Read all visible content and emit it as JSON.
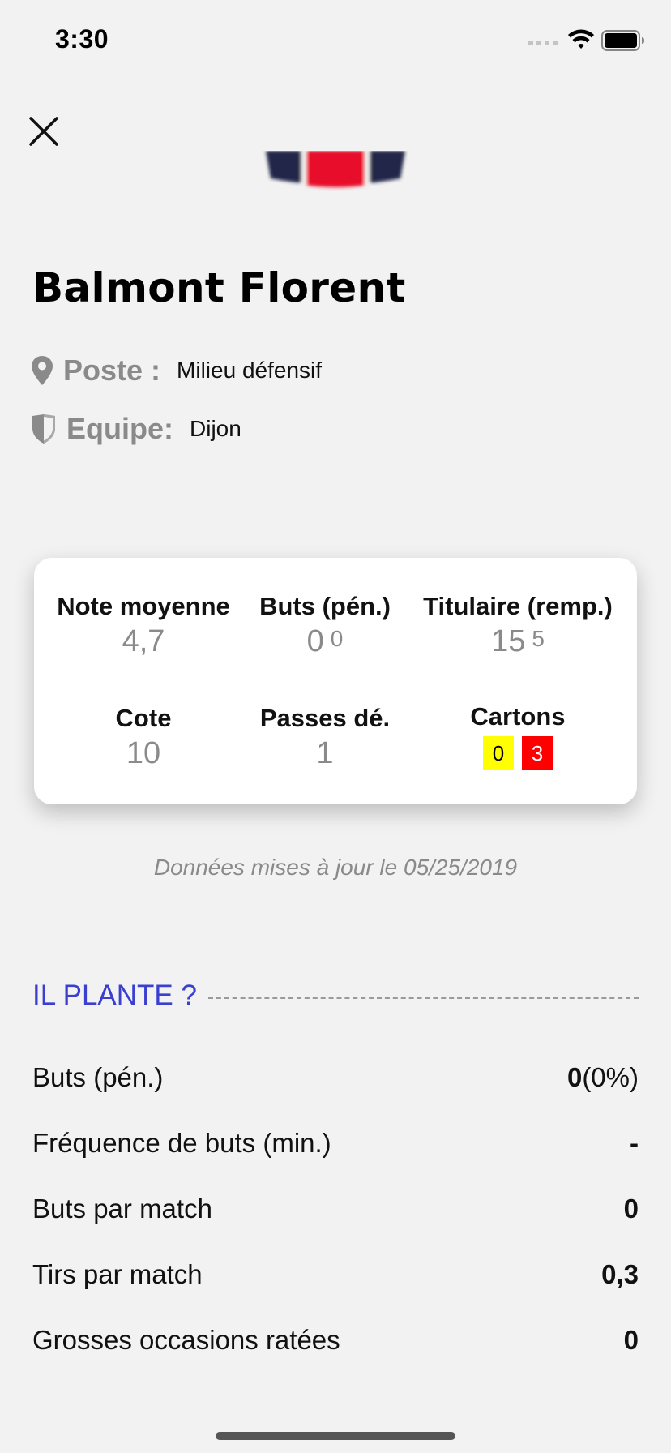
{
  "status_bar": {
    "time": "3:30"
  },
  "player": {
    "name": "Balmont Florent",
    "poste_label": "Poste :",
    "poste_value": "Milieu défensif",
    "equipe_label": "Equipe:",
    "equipe_value": "Dijon"
  },
  "stats_card": {
    "note_moyenne": {
      "title": "Note moyenne",
      "value": "4,7"
    },
    "buts": {
      "title": "Buts (pén.)",
      "value": "0",
      "sup": "0"
    },
    "titulaire": {
      "title": "Titulaire (remp.)",
      "value": "15",
      "sup": "5"
    },
    "cote": {
      "title": "Cote",
      "value": "10"
    },
    "passes": {
      "title": "Passes dé.",
      "value": "1"
    },
    "cartons": {
      "title": "Cartons",
      "yellow": "0",
      "red": "3"
    }
  },
  "update_note": "Données mises à jour le 05/25/2019",
  "section": {
    "title": "IL PLANTE ?",
    "rows": [
      {
        "label": "Buts (pén.)",
        "value": "0",
        "suffix": "(0%)"
      },
      {
        "label": "Fréquence de buts (min.)",
        "value": "-",
        "suffix": ""
      },
      {
        "label": "Buts par match",
        "value": "0",
        "suffix": ""
      },
      {
        "label": "Tirs par match",
        "value": "0,3",
        "suffix": ""
      },
      {
        "label": "Grosses occasions ratées",
        "value": "0",
        "suffix": ""
      }
    ]
  },
  "colors": {
    "accent": "#3a3fd0",
    "card_yellow": "#ffff00",
    "card_red": "#ff0000",
    "muted": "#8a8a8a",
    "background": "#f2f2f2"
  },
  "icons": {
    "close": "close-icon",
    "location": "location-pin-icon",
    "team": "shield-icon",
    "signal": "cellular-signal-icon",
    "wifi": "wifi-icon",
    "battery": "battery-icon",
    "jersey": "team-jersey-image"
  }
}
